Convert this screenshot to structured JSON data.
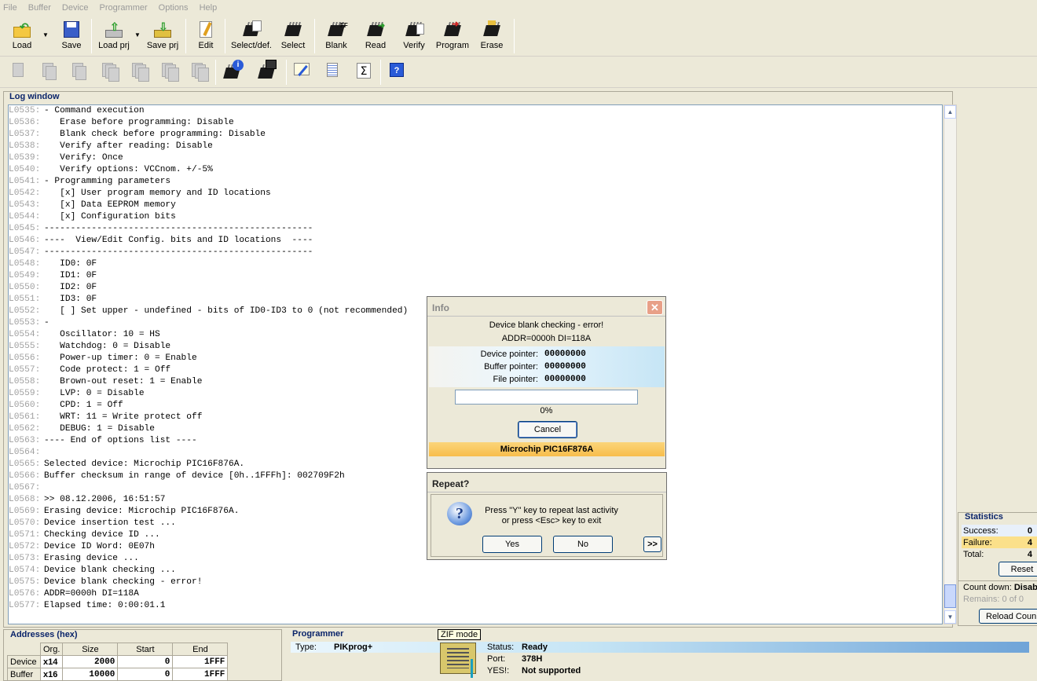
{
  "menu": [
    "File",
    "Buffer",
    "Device",
    "Programmer",
    "Options",
    "Help"
  ],
  "toolbar": {
    "load": "Load",
    "save": "Save",
    "load_prj": "Load prj",
    "save_prj": "Save prj",
    "edit": "Edit",
    "select_def": "Select/def.",
    "select": "Select",
    "blank": "Blank",
    "read": "Read",
    "verify": "Verify",
    "program": "Program",
    "erase": "Erase"
  },
  "log": {
    "title": "Log window",
    "lines": [
      {
        "n": "L0535:",
        "t": "- Command execution"
      },
      {
        "n": "L0536:",
        "t": "   Erase before programming: Disable"
      },
      {
        "n": "L0537:",
        "t": "   Blank check before programming: Disable"
      },
      {
        "n": "L0538:",
        "t": "   Verify after reading: Disable"
      },
      {
        "n": "L0539:",
        "t": "   Verify: Once"
      },
      {
        "n": "L0540:",
        "t": "   Verify options: VCCnom. +/-5%"
      },
      {
        "n": "L0541:",
        "t": "- Programming parameters"
      },
      {
        "n": "L0542:",
        "t": "   [x] User program memory and ID locations"
      },
      {
        "n": "L0543:",
        "t": "   [x] Data EEPROM memory"
      },
      {
        "n": "L0544:",
        "t": "   [x] Configuration bits"
      },
      {
        "n": "L0545:",
        "t": "---------------------------------------------------"
      },
      {
        "n": "L0546:",
        "t": "----  View/Edit Config. bits and ID locations  ----"
      },
      {
        "n": "L0547:",
        "t": "---------------------------------------------------"
      },
      {
        "n": "L0548:",
        "t": "   ID0: 0F"
      },
      {
        "n": "L0549:",
        "t": "   ID1: 0F"
      },
      {
        "n": "L0550:",
        "t": "   ID2: 0F"
      },
      {
        "n": "L0551:",
        "t": "   ID3: 0F"
      },
      {
        "n": "L0552:",
        "t": "   [ ] Set upper - undefined - bits of ID0-ID3 to 0 (not recommended)"
      },
      {
        "n": "L0553:",
        "t": "-"
      },
      {
        "n": "L0554:",
        "t": "   Oscillator: 10 = HS"
      },
      {
        "n": "L0555:",
        "t": "   Watchdog: 0 = Disable"
      },
      {
        "n": "L0556:",
        "t": "   Power-up timer: 0 = Enable"
      },
      {
        "n": "L0557:",
        "t": "   Code protect: 1 = Off"
      },
      {
        "n": "L0558:",
        "t": "   Brown-out reset: 1 = Enable"
      },
      {
        "n": "L0559:",
        "t": "   LVP: 0 = Disable"
      },
      {
        "n": "L0560:",
        "t": "   CPD: 1 = Off"
      },
      {
        "n": "L0561:",
        "t": "   WRT: 11 = Write protect off"
      },
      {
        "n": "L0562:",
        "t": "   DEBUG: 1 = Disable"
      },
      {
        "n": "L0563:",
        "t": "---- End of options list ----"
      },
      {
        "n": "L0564:",
        "t": ""
      },
      {
        "n": "L0565:",
        "t": "Selected device: Microchip PIC16F876A."
      },
      {
        "n": "L0566:",
        "t": "Buffer checksum in range of device [0h..1FFFh]: 002709F2h"
      },
      {
        "n": "L0567:",
        "t": ""
      },
      {
        "n": "L0568:",
        "t": ">> 08.12.2006, 16:51:57"
      },
      {
        "n": "L0569:",
        "t": "Erasing device: Microchip PIC16F876A."
      },
      {
        "n": "L0570:",
        "t": "Device insertion test ..."
      },
      {
        "n": "L0571:",
        "t": "Checking device ID ..."
      },
      {
        "n": "L0572:",
        "t": "Device ID Word: 0E07h"
      },
      {
        "n": "L0573:",
        "t": "Erasing device ..."
      },
      {
        "n": "L0574:",
        "t": "Device blank checking ..."
      },
      {
        "n": "L0575:",
        "t": "Device blank checking - error!"
      },
      {
        "n": "L0576:",
        "t": "ADDR=0000h DI=118A"
      },
      {
        "n": "L0577:",
        "t": "Elapsed time: 0:00:01.1"
      }
    ]
  },
  "statistics": {
    "title": "Statistics",
    "success_label": "Success:",
    "success": "0",
    "failure_label": "Failure:",
    "failure": "4",
    "total_label": "Total:",
    "total": "4",
    "reset": "Reset",
    "count_down_label": "Count down:",
    "count_down_value": "Disab",
    "remains_label": "Remains:",
    "remains_value": "0 of 0",
    "reload": "Reload Coun"
  },
  "addresses": {
    "title": "Addresses (hex)",
    "headers": [
      "Org.",
      "Size",
      "Start",
      "End"
    ],
    "rows": [
      {
        "label": "Device",
        "org": "x14",
        "size": "2000",
        "start": "0",
        "end": "1FFF"
      },
      {
        "label": "Buffer",
        "org": "x16",
        "size": "10000",
        "start": "0",
        "end": "1FFF"
      }
    ]
  },
  "programmer": {
    "title": "Programmer",
    "type_label": "Type:",
    "type": "PIKprog+",
    "zif_label": "ZIF mode",
    "status_label": "Status:",
    "status": "Ready",
    "port_label": "Port:",
    "port": "378H",
    "yes_label": "YES!:",
    "yes": "Not supported"
  },
  "info_dialog": {
    "title": "Info",
    "line1": "Device blank checking - error!",
    "line2": "ADDR=0000h DI=118A",
    "device_ptr_label": "Device pointer:",
    "device_ptr": "00000000",
    "buffer_ptr_label": "Buffer pointer:",
    "buffer_ptr": "00000000",
    "file_ptr_label": "File pointer:",
    "file_ptr": "00000000",
    "progress_text": "0%",
    "progress": 0,
    "cancel": "Cancel",
    "device_name": "Microchip  PIC16F876A"
  },
  "repeat_dialog": {
    "title": "Repeat?",
    "line1": "Press \"Y\" key to repeat last activity",
    "line2": "or press <Esc> key to exit",
    "yes": "Yes",
    "no": "No",
    "more": ">>"
  }
}
